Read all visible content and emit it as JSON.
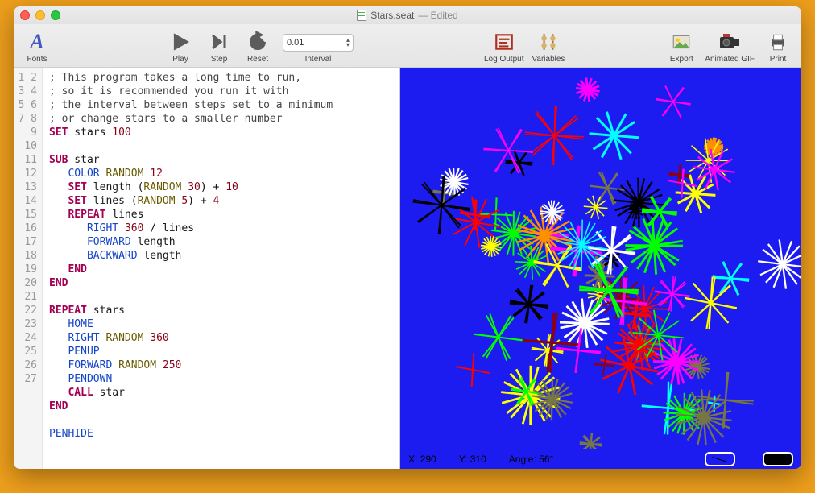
{
  "window": {
    "filename": "Stars.seat",
    "edited_label": "— Edited"
  },
  "toolbar": {
    "fonts": "Fonts",
    "play": "Play",
    "step": "Step",
    "reset": "Reset",
    "interval": "Interval",
    "interval_value": "0.01",
    "log_output": "Log Output",
    "variables": "Variables",
    "export": "Export",
    "animated_gif": "Animated GIF",
    "print": "Print"
  },
  "code": {
    "line_count": 27,
    "lines": [
      {
        "n": 1,
        "raw": "; This program takes a long time to run,",
        "cls": "comment"
      },
      {
        "n": 2,
        "raw": "; so it is recommended you run it with",
        "cls": "comment"
      },
      {
        "n": 3,
        "raw": "; the interval between steps set to a minimum",
        "cls": "comment"
      },
      {
        "n": 4,
        "raw": "; or change stars to a smaller number",
        "cls": "comment"
      },
      {
        "n": 5,
        "tokens": [
          [
            "kw-set",
            "SET"
          ],
          [
            "ident",
            " stars "
          ],
          [
            "num",
            "100"
          ]
        ]
      },
      {
        "n": 6,
        "raw": "",
        "cls": ""
      },
      {
        "n": 7,
        "tokens": [
          [
            "kw-sub",
            "SUB"
          ],
          [
            "ident",
            " star"
          ]
        ]
      },
      {
        "n": 8,
        "tokens": [
          [
            "",
            "   "
          ],
          [
            "cmd",
            "COLOR"
          ],
          [
            "",
            " "
          ],
          [
            "func",
            "RANDOM"
          ],
          [
            "",
            " "
          ],
          [
            "num",
            "12"
          ]
        ]
      },
      {
        "n": 9,
        "tokens": [
          [
            "",
            "   "
          ],
          [
            "kw-set",
            "SET"
          ],
          [
            "ident",
            " length "
          ],
          [
            "",
            "("
          ],
          [
            "func",
            "RANDOM"
          ],
          [
            "",
            " "
          ],
          [
            "num",
            "30"
          ],
          [
            "",
            ") + "
          ],
          [
            "num",
            "10"
          ]
        ]
      },
      {
        "n": 10,
        "tokens": [
          [
            "",
            "   "
          ],
          [
            "kw-set",
            "SET"
          ],
          [
            "ident",
            " lines "
          ],
          [
            "",
            "("
          ],
          [
            "func",
            "RANDOM"
          ],
          [
            "",
            " "
          ],
          [
            "num",
            "5"
          ],
          [
            "",
            ") + "
          ],
          [
            "num",
            "4"
          ]
        ]
      },
      {
        "n": 11,
        "tokens": [
          [
            "",
            "   "
          ],
          [
            "kw-repeat",
            "REPEAT"
          ],
          [
            "ident",
            " lines"
          ]
        ]
      },
      {
        "n": 12,
        "tokens": [
          [
            "",
            "      "
          ],
          [
            "cmd",
            "RIGHT"
          ],
          [
            "",
            " "
          ],
          [
            "num",
            "360"
          ],
          [
            "",
            " / lines"
          ]
        ]
      },
      {
        "n": 13,
        "tokens": [
          [
            "",
            "      "
          ],
          [
            "cmd",
            "FORWARD"
          ],
          [
            "ident",
            " length"
          ]
        ]
      },
      {
        "n": 14,
        "tokens": [
          [
            "",
            "      "
          ],
          [
            "cmd",
            "BACKWARD"
          ],
          [
            "ident",
            " length"
          ]
        ]
      },
      {
        "n": 15,
        "tokens": [
          [
            "",
            "   "
          ],
          [
            "kw-end",
            "END"
          ]
        ]
      },
      {
        "n": 16,
        "tokens": [
          [
            "kw-end",
            "END"
          ]
        ]
      },
      {
        "n": 17,
        "raw": "",
        "cls": ""
      },
      {
        "n": 18,
        "tokens": [
          [
            "kw-repeat",
            "REPEAT"
          ],
          [
            "ident",
            " stars"
          ]
        ]
      },
      {
        "n": 19,
        "tokens": [
          [
            "",
            "   "
          ],
          [
            "cmd",
            "HOME"
          ]
        ]
      },
      {
        "n": 20,
        "tokens": [
          [
            "",
            "   "
          ],
          [
            "cmd",
            "RIGHT"
          ],
          [
            "",
            " "
          ],
          [
            "func",
            "RANDOM"
          ],
          [
            "",
            " "
          ],
          [
            "num",
            "360"
          ]
        ]
      },
      {
        "n": 21,
        "tokens": [
          [
            "",
            "   "
          ],
          [
            "cmd",
            "PENUP"
          ]
        ]
      },
      {
        "n": 22,
        "tokens": [
          [
            "",
            "   "
          ],
          [
            "cmd",
            "FORWARD"
          ],
          [
            "",
            " "
          ],
          [
            "func",
            "RANDOM"
          ],
          [
            "",
            " "
          ],
          [
            "num",
            "250"
          ]
        ]
      },
      {
        "n": 23,
        "tokens": [
          [
            "",
            "   "
          ],
          [
            "cmd",
            "PENDOWN"
          ]
        ]
      },
      {
        "n": 24,
        "tokens": [
          [
            "",
            "   "
          ],
          [
            "kw-set",
            "CALL"
          ],
          [
            "ident",
            " star"
          ]
        ]
      },
      {
        "n": 25,
        "tokens": [
          [
            "kw-end",
            "END"
          ]
        ]
      },
      {
        "n": 26,
        "raw": "",
        "cls": ""
      },
      {
        "n": 27,
        "tokens": [
          [
            "cmd",
            "PENHIDE"
          ]
        ]
      }
    ]
  },
  "canvas": {
    "bg": "#1c1cf0",
    "status": {
      "x_label": "X:",
      "x": "290",
      "y_label": "Y:",
      "y": "310",
      "angle_label": "Angle:",
      "angle": "56°"
    },
    "star_colors": [
      "#ffffff",
      "#ff00ff",
      "#00ffff",
      "#ffff00",
      "#ff0000",
      "#00ff00",
      "#ff9100",
      "#000000",
      "#777744",
      "#8b0016"
    ]
  }
}
